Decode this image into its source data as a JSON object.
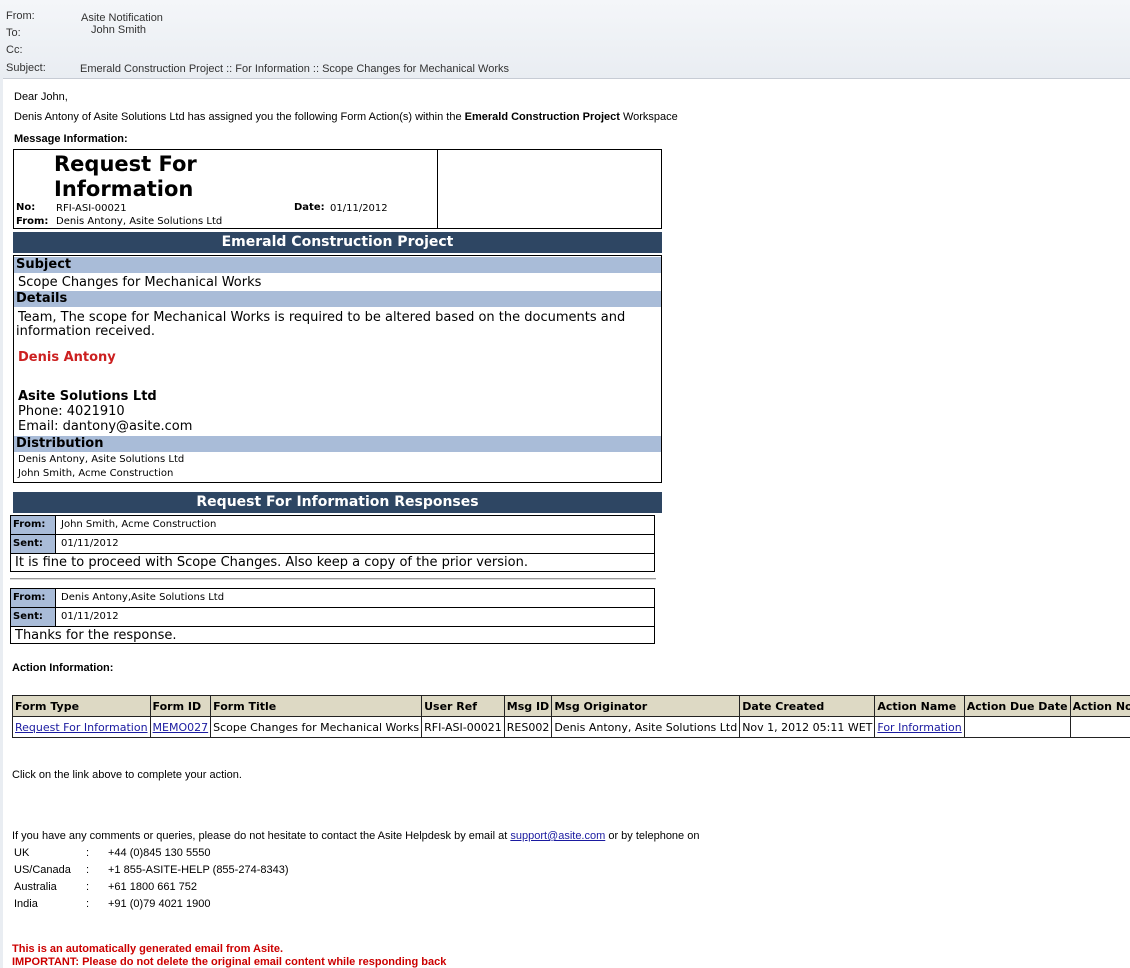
{
  "email_header": {
    "from_label": "From:",
    "from_value": "Asite Notification",
    "to_label": "To:",
    "to_value": "John Smith",
    "cc_label": "Cc:",
    "subject_label": "Subject:",
    "subject_value": "Emerald Construction Project :: For Information :: Scope Changes for Mechanical Works"
  },
  "intro": {
    "greeting": "Dear John,",
    "line_prefix": "Denis Antony of Asite Solutions Ltd has assigned you the following Form Action(s) within the ",
    "line_bold": "Emerald Construction Project",
    "line_suffix": " Workspace",
    "message_info_label": "Message Information:"
  },
  "rfi": {
    "title_line1": "Request For",
    "title_line2": "Information",
    "no_label": "No:",
    "no_value": "RFI-ASI-00021",
    "date_label": "Date:",
    "date_value": "01/11/2012",
    "from_label": "From:",
    "from_value": "Denis Antony, Asite Solutions Ltd",
    "project_bar": "Emerald Construction Project",
    "subject_label": "Subject",
    "subject_value": "Scope Changes for Mechanical Works",
    "details_label": "Details",
    "details_text_1": "Team, The scope for Mechanical Works is required to be altered based on the documents and",
    "details_text_2": "information received.",
    "signature_name": "Denis Antony",
    "signature_company": "Asite Solutions Ltd",
    "signature_phone": "Phone: 4021910",
    "signature_email": "Email: dantony@asite.com",
    "distribution_label": "Distribution",
    "distribution": [
      "Denis Antony, Asite Solutions Ltd",
      "John Smith, Acme Construction"
    ]
  },
  "responses": {
    "bar": "Request For Information Responses",
    "from_label": "From:",
    "sent_label": "Sent:",
    "items": [
      {
        "from": "John Smith, Acme Construction",
        "sent": "01/11/2012",
        "message": "It is fine to proceed with Scope Changes. Also keep a copy of the prior version."
      },
      {
        "from": "Denis Antony,Asite Solutions Ltd",
        "sent": "01/11/2012",
        "message": "Thanks for the response."
      }
    ]
  },
  "action_info": {
    "label": "Action Information:",
    "headers": [
      "Form Type",
      "Form ID",
      "Form Title",
      "User Ref",
      "Msg ID",
      "Msg Originator",
      "Date Created",
      "Action Name",
      "Action Due Date",
      "Action Notes"
    ],
    "row": {
      "form_type": "Request For Information",
      "form_id": "MEMO027",
      "form_title": "Scope Changes for Mechanical Works",
      "user_ref": "RFI-ASI-00021",
      "msg_id": "RES002",
      "msg_originator": "Denis Antony, Asite Solutions Ltd",
      "date_created": "Nov 1, 2012 05:11 WET",
      "action_name": "For Information",
      "action_due_date": "",
      "action_notes": ""
    },
    "instruction": "Click on the link above to complete your action."
  },
  "helpdesk": {
    "text_prefix": "If you have any comments or queries, please do not hesitate to contact the Asite Helpdesk by email at ",
    "email_link": "support@asite.com",
    "text_suffix": " or by telephone on",
    "phones": [
      {
        "region": "UK",
        "sep": ":",
        "number": "+44 (0)845 130 5550"
      },
      {
        "region": "US/Canada",
        "sep": ":",
        "number": "+1 855-ASITE-HELP (855-274-8343)"
      },
      {
        "region": "Australia",
        "sep": ":",
        "number": "+61 1800 661 752"
      },
      {
        "region": "India",
        "sep": ":",
        "number": "+91 (0)79 4021 1900"
      }
    ]
  },
  "footer": {
    "auto_line": "This is an automatically generated email from Asite.",
    "important_line": "IMPORTANT: Please do not delete the original email content while responding back"
  }
}
